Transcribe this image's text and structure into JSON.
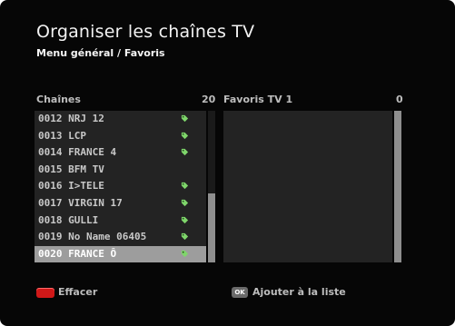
{
  "header": {
    "title": "Organiser les chaînes TV",
    "breadcrumb": "Menu général / Favoris"
  },
  "channels": {
    "heading": "Chaînes",
    "count": "20",
    "items": [
      {
        "label": "0012 NRJ 12",
        "tagged": true
      },
      {
        "label": "0013 LCP",
        "tagged": true
      },
      {
        "label": "0014 FRANCE 4",
        "tagged": true
      },
      {
        "label": "0015 BFM TV",
        "tagged": false
      },
      {
        "label": "0016 I>TELE",
        "tagged": true
      },
      {
        "label": "0017 VIRGIN 17",
        "tagged": true
      },
      {
        "label": "0018 GULLI",
        "tagged": true
      },
      {
        "label": "0019 No Name 06405",
        "tagged": true
      },
      {
        "label": "0020 FRANCE Ô",
        "tagged": true
      }
    ],
    "selected_index": 8,
    "tag_icon": "tag-icon",
    "tag_color": "#7fd66b"
  },
  "favorites": {
    "heading": "Favoris TV 1",
    "count": "0",
    "items": []
  },
  "footer": {
    "red_key_label": "Effacer",
    "red_key_color": "#d01818",
    "ok_key_text": "OK",
    "ok_key_label": "Ajouter à la liste"
  }
}
